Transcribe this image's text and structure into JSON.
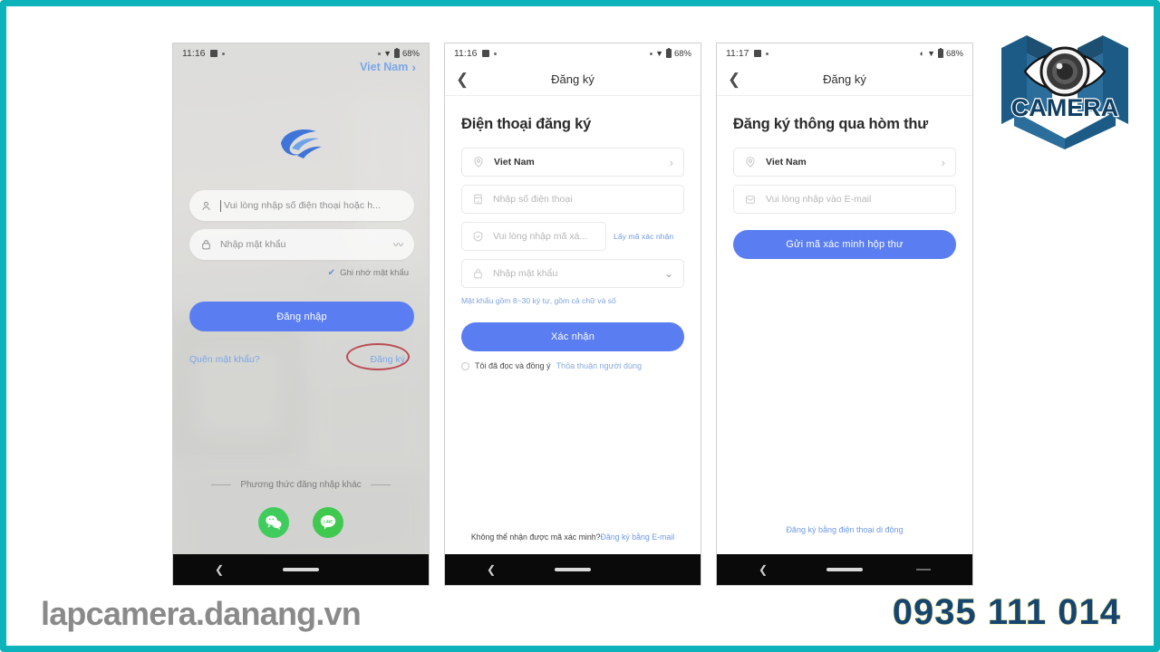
{
  "border_color": "#0cb3bb",
  "brand": {
    "logo_text": "CAMERA",
    "logo_alt": "camera-eye-logo"
  },
  "footer": {
    "website": "lapcamera.danang.vn",
    "phone": "0935 111 014"
  },
  "screens": [
    {
      "id": "login",
      "status_bar": {
        "time": "11:16",
        "battery": "68%"
      },
      "country_selector": "Viet Nam",
      "fields": [
        {
          "icon": "user-icon",
          "placeholder": "Vui lòng nhập số điện thoại hoặc h..."
        },
        {
          "icon": "lock-icon",
          "placeholder": "Nhập mật khẩu"
        }
      ],
      "remember_label": "Ghi nhớ mật khẩu",
      "login_button": "Đăng nhập",
      "forgot_link": "Quên mật khẩu?",
      "register_link": "Đăng ký",
      "other_login_label": "Phương thức đăng nhập khác",
      "socials": [
        {
          "name": "wechat-icon",
          "glyph": "💬"
        },
        {
          "name": "line-icon",
          "glyph": "LINE"
        }
      ]
    },
    {
      "id": "register-phone",
      "status_bar": {
        "time": "11:16",
        "battery": "68%"
      },
      "nav_title": "Đăng ký",
      "page_title": "Điện thoại đăng ký",
      "country_value": "Viet Nam",
      "phone_placeholder": "Nhập số điện thoại",
      "code_placeholder": "Vui lòng nhập mã xá...",
      "get_code_label": "Lấy mã xác nhận",
      "password_placeholder": "Nhập mật khẩu",
      "password_hint": "Mật khẩu gồm 8~30 ký tự, gồm cả chữ và số",
      "confirm_button": "Xác nhận",
      "agree_text": "Tôi đã đọc và đồng ý",
      "agree_link": "Thỏa thuận người dùng",
      "bottom_question": "Không thể nhận được mã xác minh?",
      "bottom_link": "Đăng ký bằng E-mail"
    },
    {
      "id": "register-email",
      "status_bar": {
        "time": "11:17",
        "battery": "68%"
      },
      "nav_title": "Đăng ký",
      "page_title": "Đăng ký thông qua hòm thư",
      "country_value": "Viet Nam",
      "email_placeholder": "Vui lòng nhập vào E-mail",
      "send_button": "Gửi mã xác minh hộp thư",
      "bottom_link": "Đăng ký bằng điện thoại di động"
    }
  ]
}
